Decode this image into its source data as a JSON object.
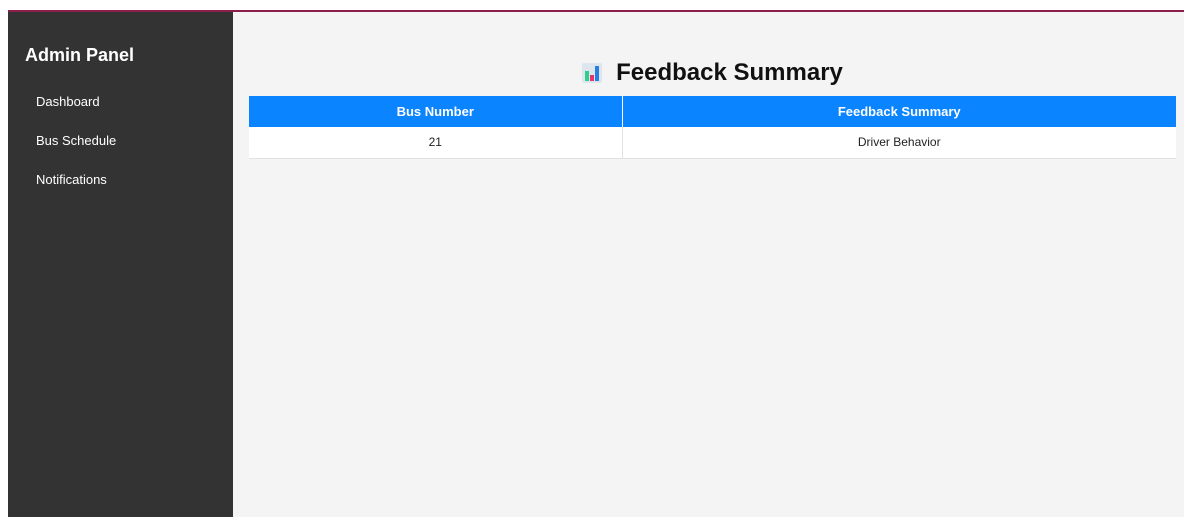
{
  "sidebar": {
    "title": "Admin Panel",
    "items": [
      {
        "label": "Dashboard"
      },
      {
        "label": "Bus Schedule"
      },
      {
        "label": "Notifications"
      }
    ]
  },
  "main": {
    "title": "Feedback Summary",
    "title_icon": "bar-chart-icon",
    "table": {
      "headers": [
        "Bus Number",
        "Feedback Summary"
      ],
      "rows": [
        [
          "21",
          "Driver Behavior"
        ]
      ]
    }
  },
  "colors": {
    "sidebar_bg": "#333333",
    "header_bg": "#0a84ff",
    "accent_border": "#8b1e4a",
    "content_bg": "#f4f4f4"
  }
}
